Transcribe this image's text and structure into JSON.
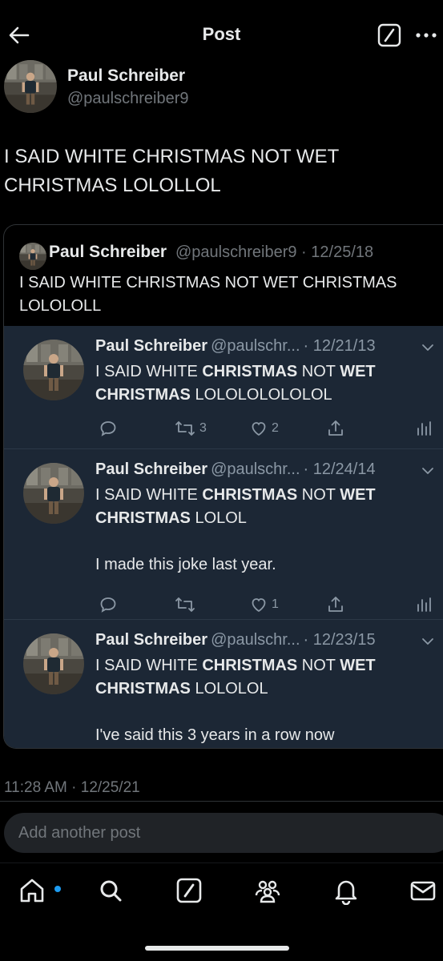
{
  "header": {
    "title": "Post"
  },
  "post": {
    "author_name": "Paul Schreiber",
    "author_handle": "@paulschreiber9",
    "text": "I SAID WHITE CHRISTMAS NOT WET CHRISTMAS LOLOLLOL",
    "timestamp": "11:28 AM · 12/25/21"
  },
  "quote": {
    "author_name": "Paul Schreiber",
    "author_handle": "@paulschreiber9 · 12/25/18",
    "text": "I SAID WHITE CHRISTMAS NOT WET CHRISTMAS LOLOLOLL"
  },
  "replies": [
    {
      "name": "Paul Schreiber",
      "handle": "@paulschr...",
      "date": "· 12/21/13",
      "text_a": "I SAID WHITE ",
      "text_b": "CHRISTMAS",
      "text_c": " NOT ",
      "text_d": "WET CHRISTMAS",
      "text_e": " LOLOLOLOLOLOL",
      "extra": "",
      "retweets": "3",
      "likes": "2"
    },
    {
      "name": "Paul Schreiber",
      "handle": "@paulschr...",
      "date": "· 12/24/14",
      "text_a": "I SAID WHITE ",
      "text_b": "CHRISTMAS",
      "text_c": " NOT ",
      "text_d": "WET CHRISTMAS",
      "text_e": " LOLOL",
      "extra": "I made this joke last year.",
      "retweets": "",
      "likes": "1"
    },
    {
      "name": "Paul Schreiber",
      "handle": "@paulschr...",
      "date": "· 12/23/15",
      "text_a": "I SAID WHITE ",
      "text_b": "CHRISTMAS",
      "text_c": " NOT ",
      "text_d": "WET CHRISTMAS",
      "text_e": " LOLOLOL",
      "extra": "I've said this 3 years in a row now"
    }
  ],
  "composer": {
    "placeholder": "Add another post"
  },
  "tabs": [
    "home",
    "search",
    "grok",
    "communities",
    "notifications",
    "messages"
  ],
  "icons": {
    "back": "arrow-left-icon",
    "grok": "grok-icon",
    "more": "more-icon",
    "reply": "reply-icon",
    "retweet": "retweet-icon",
    "like": "heart-icon",
    "share": "share-icon",
    "views": "views-icon",
    "chevron": "chevron-down-icon"
  },
  "colors": {
    "background": "#000000",
    "embed_background": "#1c2735",
    "text": "#e7e9ea",
    "muted": "#71767b",
    "accent": "#1d9bf0"
  }
}
